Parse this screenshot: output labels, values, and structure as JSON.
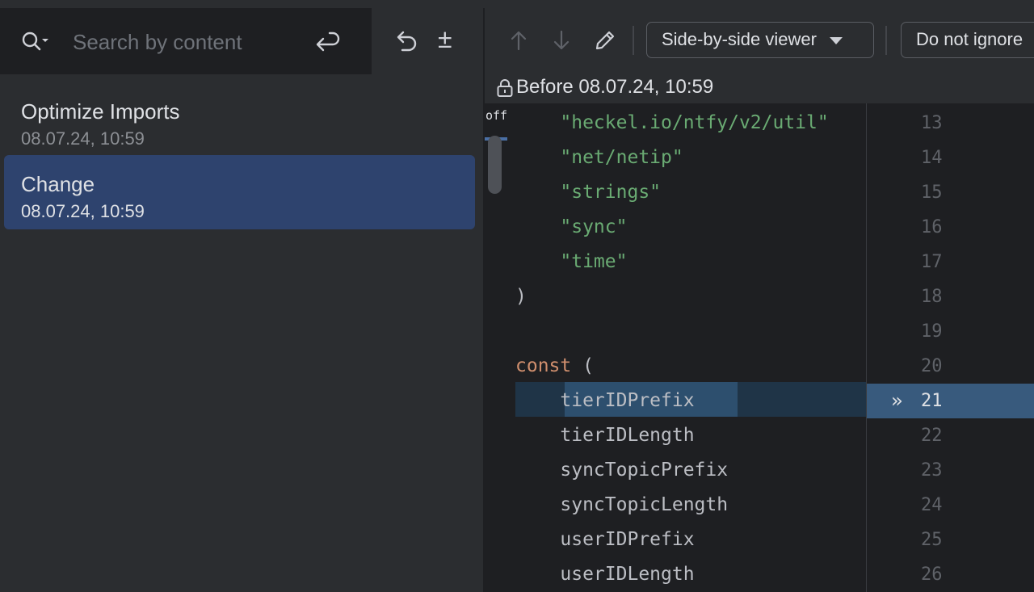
{
  "search": {
    "placeholder": "Search by content"
  },
  "history": [
    {
      "title": "Optimize Imports",
      "date": "08.07.24, 10:59",
      "selected": false
    },
    {
      "title": "Change",
      "date": "08.07.24, 10:59",
      "selected": true
    }
  ],
  "toolbar": {
    "viewer_label": "Side-by-side viewer",
    "ignore_label": "Do not ignore"
  },
  "pane": {
    "title": "Before 08.07.24, 10:59",
    "gutter_label": "off"
  },
  "code_lines": [
    {
      "num": "13",
      "text": "    \"heckel.io/ntfy/v2/util\"",
      "kind": "str"
    },
    {
      "num": "14",
      "text": "    \"net/netip\"",
      "kind": "str"
    },
    {
      "num": "15",
      "text": "    \"strings\"",
      "kind": "str"
    },
    {
      "num": "16",
      "text": "    \"sync\"",
      "kind": "str"
    },
    {
      "num": "17",
      "text": "    \"time\"",
      "kind": "str"
    },
    {
      "num": "18",
      "text": ")",
      "kind": "plain"
    },
    {
      "num": "19",
      "text": "",
      "kind": "plain"
    },
    {
      "num": "20",
      "text": "const (",
      "kind": "const"
    },
    {
      "num": "21",
      "text": "    tierIDPrefix",
      "kind": "plain",
      "highlight": true
    },
    {
      "num": "22",
      "text": "    tierIDLength",
      "kind": "plain"
    },
    {
      "num": "23",
      "text": "    syncTopicPrefix",
      "kind": "plain"
    },
    {
      "num": "24",
      "text": "    syncTopicLength",
      "kind": "plain"
    },
    {
      "num": "25",
      "text": "    userIDPrefix",
      "kind": "plain"
    },
    {
      "num": "26",
      "text": "    userIDLength",
      "kind": "plain"
    }
  ],
  "icons": {
    "search": "search-icon",
    "enter": "enter-icon",
    "revert": "revert-icon",
    "show_diff": "plus-minus-icon",
    "prev": "arrow-up-icon",
    "next": "arrow-down-icon",
    "edit": "pencil-icon",
    "lock": "lock-icon",
    "chevron": "double-chevron-right-icon"
  },
  "colors": {
    "selection": "#2e436e",
    "string": "#6aab73",
    "keyword": "#cf8e6d",
    "highlight_line": "#385a7d"
  }
}
